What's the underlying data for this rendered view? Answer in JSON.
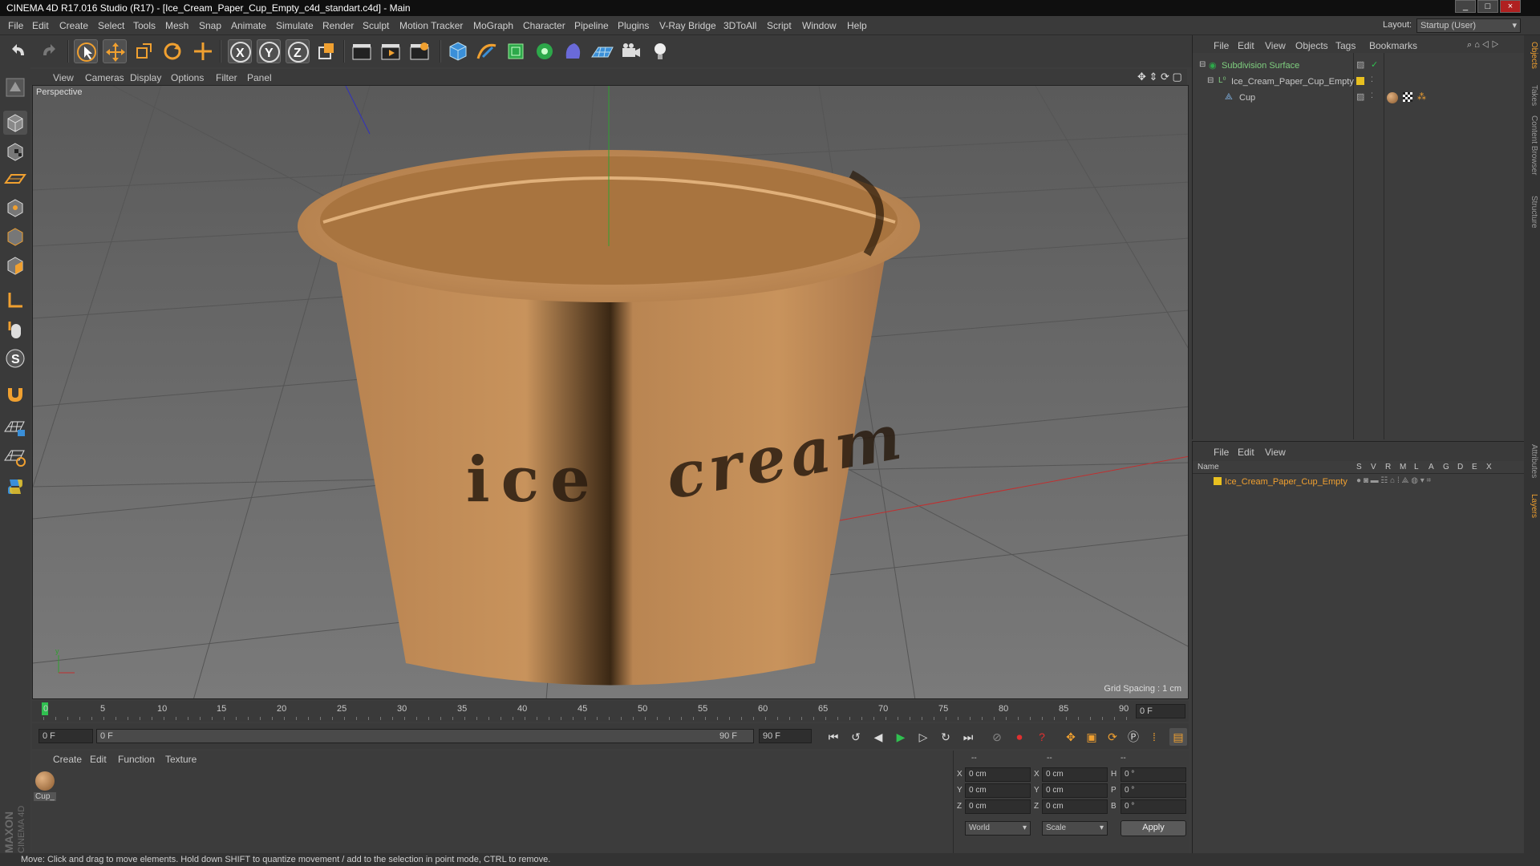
{
  "window": {
    "title": "CINEMA 4D R17.016 Studio (R17) - [Ice_Cream_Paper_Cup_Empty_c4d_standart.c4d] - Main"
  },
  "menu": [
    "File",
    "Edit",
    "Create",
    "Select",
    "Tools",
    "Mesh",
    "Snap",
    "Animate",
    "Simulate",
    "Render",
    "Sculpt",
    "Motion Tracker",
    "MoGraph",
    "Character",
    "Pipeline",
    "Plugins",
    "V-Ray Bridge",
    "3DToAll",
    "Script",
    "Window",
    "Help"
  ],
  "layout": {
    "label": "Layout:",
    "value": "Startup (User)"
  },
  "viewport": {
    "menu": [
      "View",
      "Cameras",
      "Display",
      "Options",
      "Filter",
      "Panel"
    ],
    "label": "Perspective",
    "grid_spacing": "Grid Spacing : 1 cm",
    "cup_text": "ice cream"
  },
  "timeline": {
    "ticks": [
      "0",
      "5",
      "10",
      "15",
      "20",
      "25",
      "30",
      "35",
      "40",
      "45",
      "50",
      "55",
      "60",
      "65",
      "70",
      "75",
      "80",
      "85",
      "90"
    ],
    "end_field": "0 F",
    "current_frame": "0 F",
    "range_start": "0 F",
    "range_end": "90 F",
    "max_frame": "90 F"
  },
  "material_manager": {
    "menu": [
      "Create",
      "Edit",
      "Function",
      "Texture"
    ],
    "materials": [
      {
        "name": "Cup_"
      }
    ]
  },
  "coords": {
    "header": [
      "--",
      "--",
      "--"
    ],
    "rows": [
      {
        "a_label": "X",
        "a_val": "0 cm",
        "b_label": "X",
        "b_val": "0 cm",
        "c_label": "H",
        "c_val": "0 °"
      },
      {
        "a_label": "Y",
        "a_val": "0 cm",
        "b_label": "Y",
        "b_val": "0 cm",
        "c_label": "P",
        "c_val": "0 °"
      },
      {
        "a_label": "Z",
        "a_val": "0 cm",
        "b_label": "Z",
        "b_val": "0 cm",
        "c_label": "B",
        "c_val": "0 °"
      }
    ],
    "world": "World",
    "scale": "Scale",
    "apply": "Apply"
  },
  "object_manager": {
    "menu": [
      "File",
      "Edit",
      "View",
      "Objects",
      "Tags",
      "Bookmarks"
    ],
    "objects": [
      {
        "name": "Subdivision Surface"
      },
      {
        "name": "Ice_Cream_Paper_Cup_Empty"
      },
      {
        "name": "Cup"
      }
    ]
  },
  "layer_manager": {
    "menu": [
      "File",
      "Edit",
      "View"
    ],
    "columns": [
      "Name",
      "S",
      "V",
      "R",
      "M",
      "L",
      "A",
      "G",
      "D",
      "E",
      "X"
    ],
    "layers": [
      {
        "name": "Ice_Cream_Paper_Cup_Empty",
        "color": "#e8c020"
      }
    ]
  },
  "right_tabs": [
    "Objects",
    "Takes",
    "Content Browser",
    "Structure",
    "Attributes",
    "Layers"
  ],
  "status": "Move: Click and drag to move elements. Hold down SHIFT to quantize movement / add to the selection in point mode, CTRL to remove.",
  "brand": {
    "maxon": "MAXON",
    "cinema": "CINEMA 4D"
  },
  "colors": {
    "accent": "#f0a030",
    "axis_x": "#c03030",
    "axis_y": "#30a030",
    "cup": "#c8935c"
  }
}
